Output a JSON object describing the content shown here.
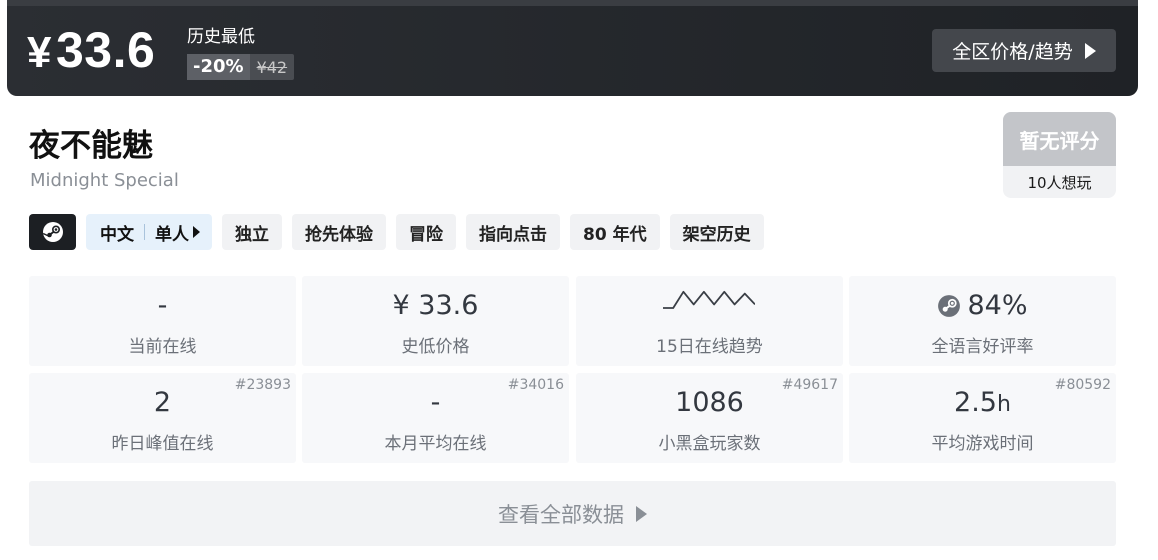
{
  "price": {
    "currency_symbol": "¥",
    "current": "33.6",
    "lowest_label": "历史最低",
    "discount": "-20%",
    "original": "¥42",
    "region_button": "全区价格/趋势"
  },
  "game": {
    "title": "夜不能魅",
    "subtitle": "Midnight Special"
  },
  "rating": {
    "score_text": "暂无评分",
    "wishlist_text": "10人想玩"
  },
  "tags": {
    "platform_icon": "steam-icon",
    "language": "中文",
    "players": "单人",
    "items": [
      "独立",
      "抢先体验",
      "冒险",
      "指向点击",
      "80 年代",
      "架空历史"
    ]
  },
  "stats": [
    {
      "value": "-",
      "label": "当前在线"
    },
    {
      "value": "¥ 33.6",
      "label": "史低价格"
    },
    {
      "value": "",
      "label": "15日在线趋势",
      "sparkline": [
        0,
        0,
        0.9,
        0.2,
        0.9,
        0.2,
        0.9,
        0.2,
        0.8,
        0.2
      ]
    },
    {
      "value": "84%",
      "label": "全语言好评率",
      "icon": "steam-icon"
    },
    {
      "value": "2",
      "label": "昨日峰值在线",
      "rank": "#23893"
    },
    {
      "value": "-",
      "label": "本月平均在线",
      "rank": "#34016"
    },
    {
      "value": "1086",
      "label": "小黑盒玩家数",
      "rank": "#49617"
    },
    {
      "value": "2.5",
      "unit": "h",
      "label": "平均游戏时间",
      "rank": "#80592"
    }
  ],
  "view_all_label": "查看全部数据",
  "colors": {
    "banner": "#24272b",
    "lang_chip": "#e6f1fb",
    "tag_chip": "#f1f2f4",
    "stat_cell": "#f7f8fa"
  }
}
